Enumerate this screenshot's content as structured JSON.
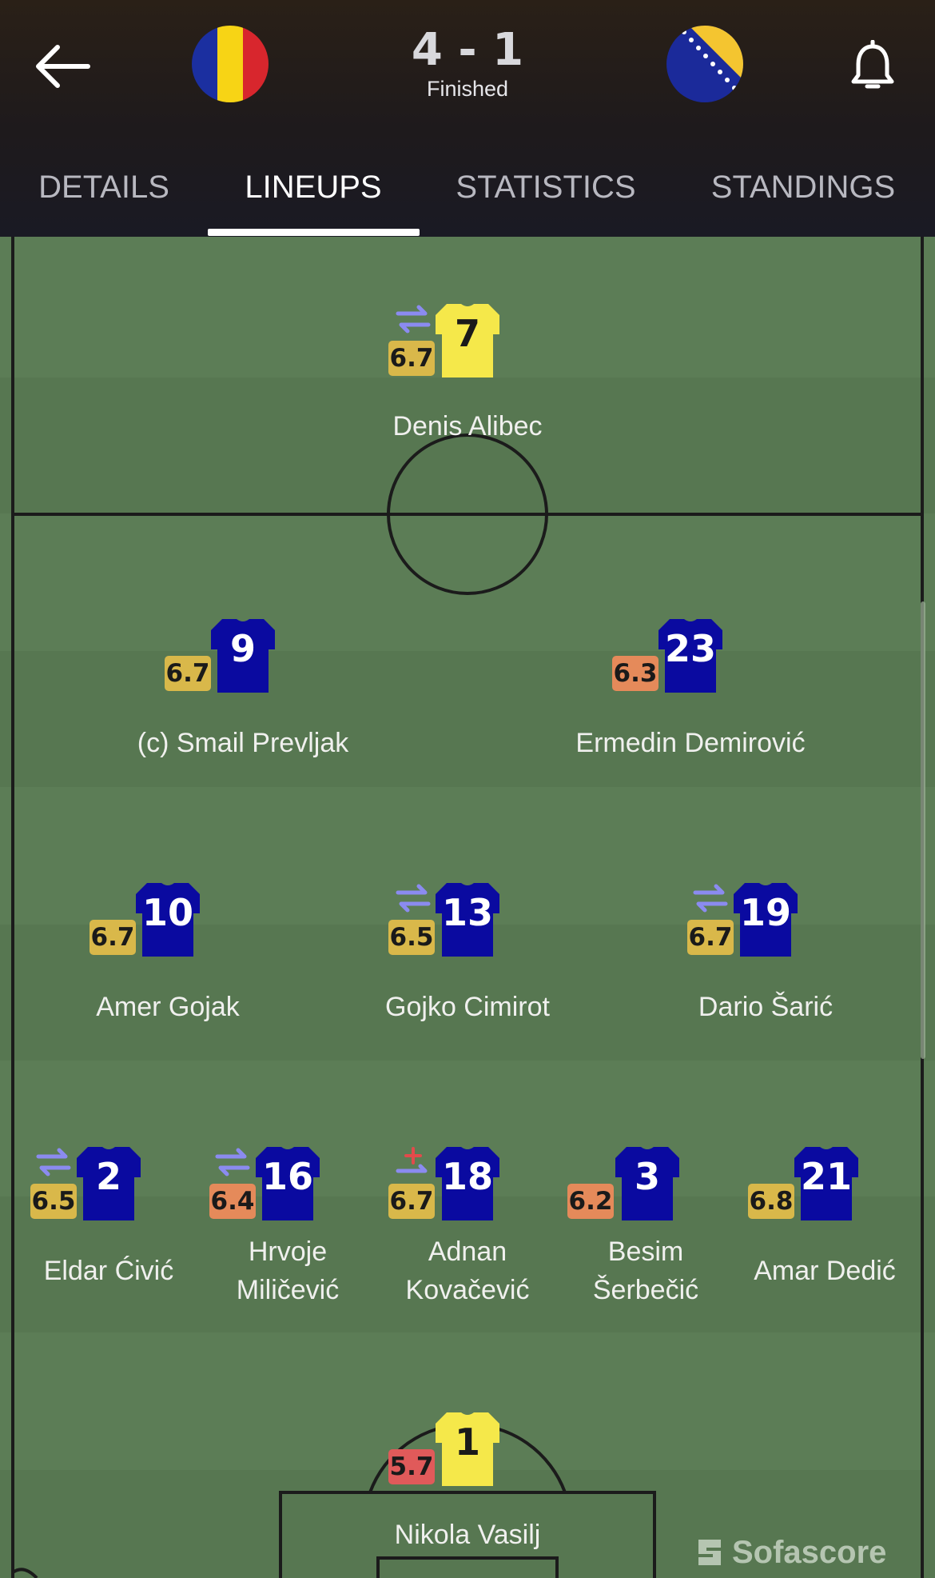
{
  "match": {
    "score": "4 - 1",
    "status": "Finished",
    "home_flag": "romania-flag",
    "away_flag": "bosnia-herzegovina-flag"
  },
  "tabs": [
    {
      "label": "DETAILS",
      "active": false
    },
    {
      "label": "LINEUPS",
      "active": true
    },
    {
      "label": "STATISTICS",
      "active": false
    },
    {
      "label": "STANDINGS",
      "active": false
    }
  ],
  "colors": {
    "header_bg": "#1e1a1c",
    "pitch": "#5c7d56",
    "home_gk_shirt": "#f5e84a",
    "away_shirt": "#0a0aa0",
    "rating_yellow": "#d9b84a",
    "rating_orange": "#e58a5a",
    "rating_red": "#e05a5a",
    "sub_icon": "#8b8bf0"
  },
  "players": {
    "alibec": {
      "number": "7",
      "rating": "6.7",
      "name": "Denis Alibec",
      "subbed": true
    },
    "prevljak": {
      "number": "9",
      "rating": "6.7",
      "name": "(c) Smail Prevljak",
      "subbed": false
    },
    "demirovic": {
      "number": "23",
      "rating": "6.3",
      "name": "Ermedin Demirović",
      "subbed": false
    },
    "gojak": {
      "number": "10",
      "rating": "6.7",
      "name": "Amer Gojak",
      "subbed": false
    },
    "cimirot": {
      "number": "13",
      "rating": "6.5",
      "name": "Gojko Cimirot",
      "subbed": true
    },
    "saric": {
      "number": "19",
      "rating": "6.7",
      "name": "Dario Šarić",
      "subbed": true
    },
    "civic": {
      "number": "2",
      "rating": "6.5",
      "name": "Eldar Ćivić",
      "subbed": true
    },
    "milicevic": {
      "number": "16",
      "rating": "6.4",
      "name_line1": "Hrvoje",
      "name_line2": "Miličević",
      "subbed": true
    },
    "kovacevic": {
      "number": "18",
      "rating": "6.7",
      "name_line1": "Adnan",
      "name_line2": "Kovačević",
      "injured": true
    },
    "serbecic": {
      "number": "3",
      "rating": "6.2",
      "name_line1": "Besim",
      "name_line2": "Šerbečić",
      "subbed": false
    },
    "dedic": {
      "number": "21",
      "rating": "6.8",
      "name": "Amar Dedić",
      "subbed": false
    },
    "vasilj": {
      "number": "1",
      "rating": "5.7",
      "name": "Nikola Vasilj",
      "subbed": false
    }
  },
  "watermark": "Sofascore"
}
